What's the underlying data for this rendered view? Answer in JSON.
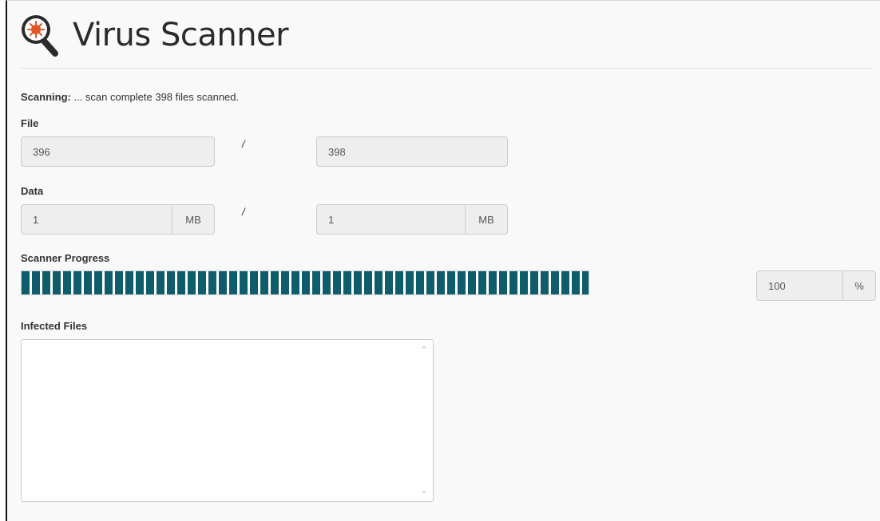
{
  "header": {
    "title": "Virus Scanner",
    "logo_icon": "virus-magnifier-icon"
  },
  "status": {
    "label": "Scanning:",
    "message": " ... scan complete 398 files scanned."
  },
  "file": {
    "label": "File",
    "current": "396",
    "separator": "/",
    "total": "398"
  },
  "data": {
    "label": "Data",
    "current": "1",
    "current_unit": "MB",
    "separator": "/",
    "total": "1",
    "total_unit": "MB"
  },
  "progress": {
    "label": "Scanner Progress",
    "percent": 100,
    "value_text": "100",
    "unit": "%",
    "bar_color": "#0e5c6c"
  },
  "infected": {
    "label": "Infected Files",
    "value": ""
  }
}
